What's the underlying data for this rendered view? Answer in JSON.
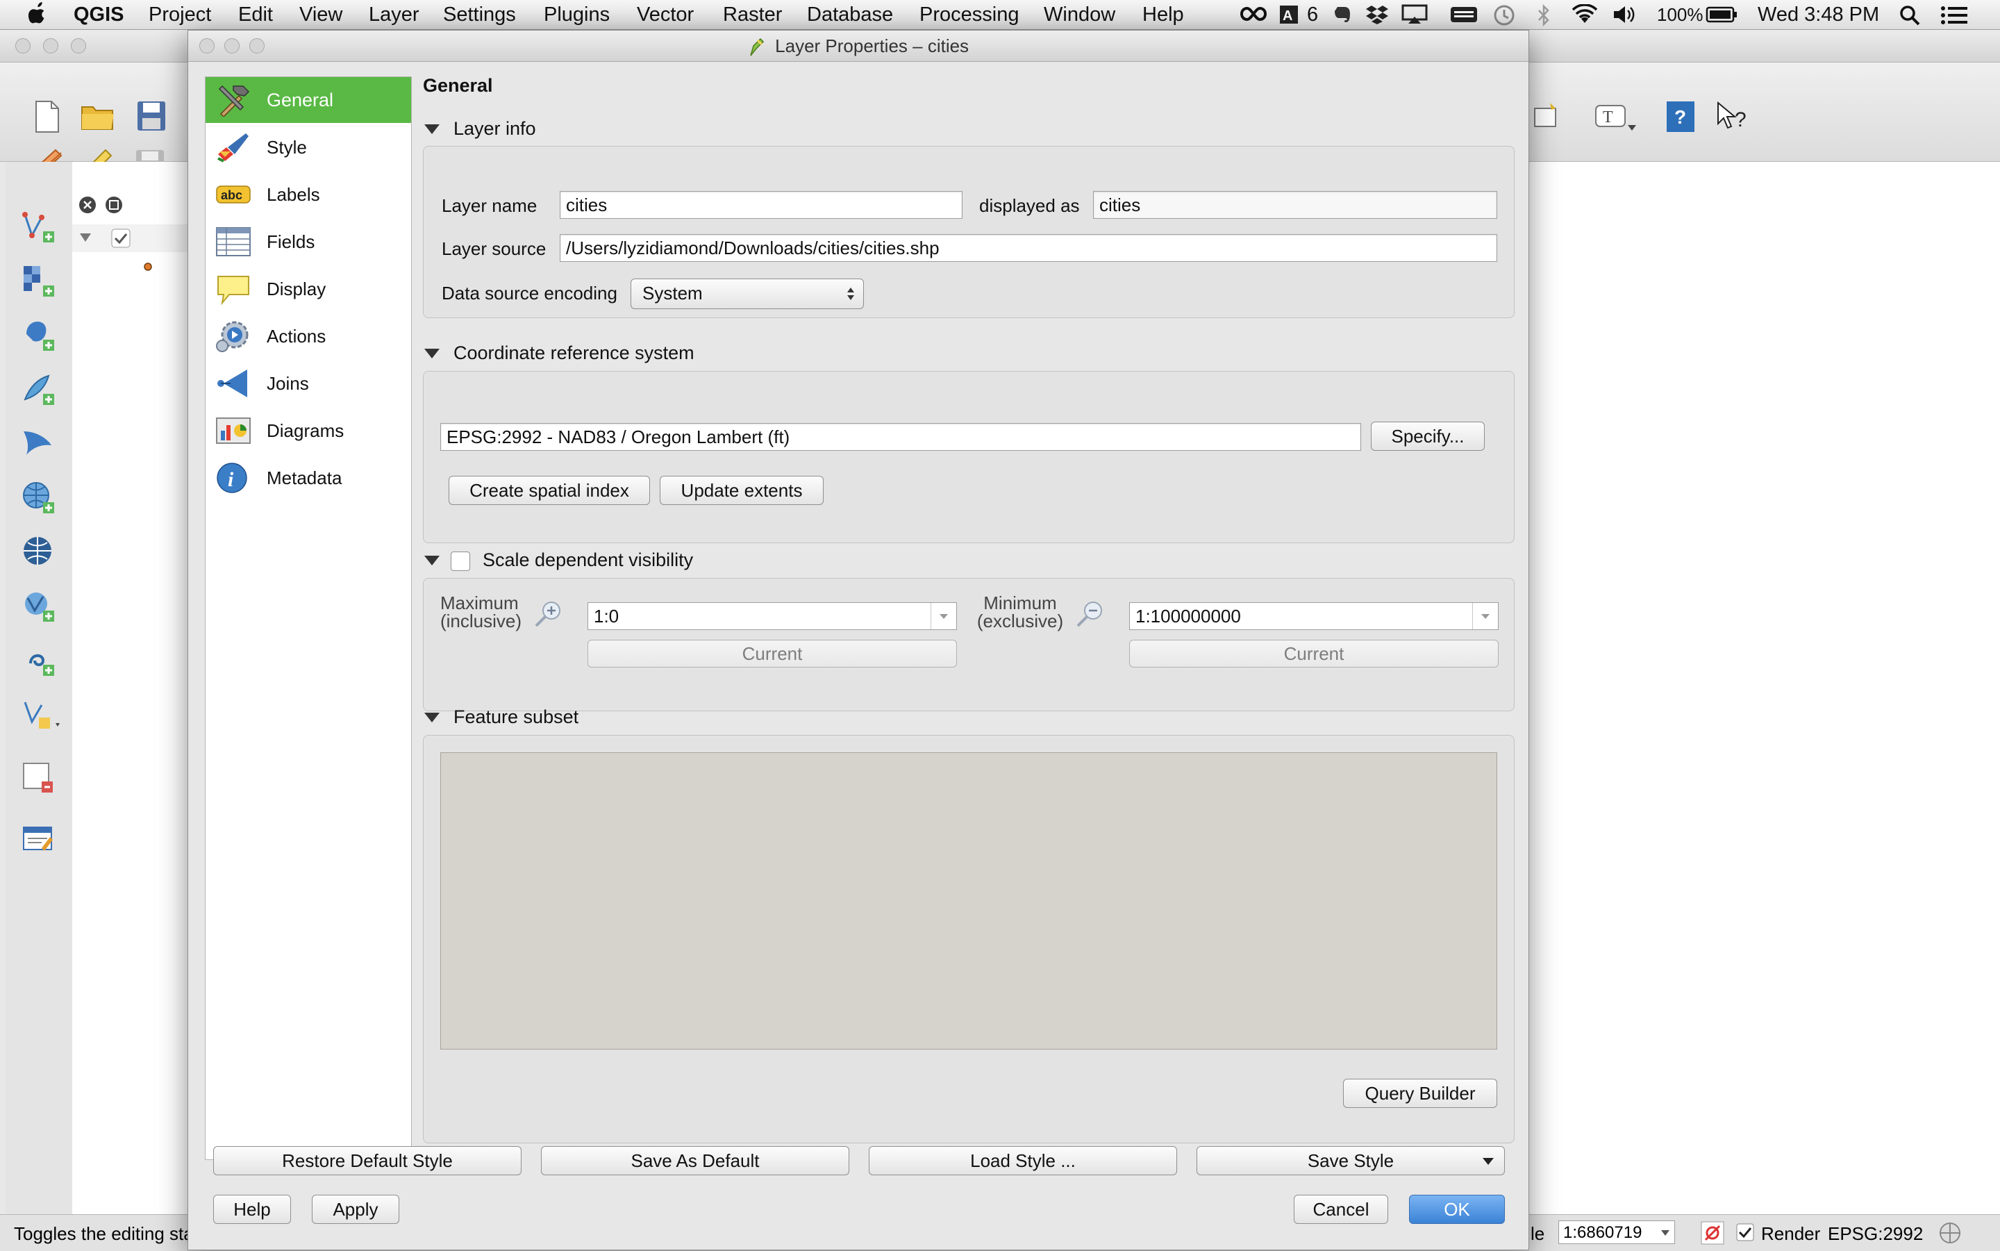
{
  "menubar": {
    "app_name": "QGIS",
    "items": [
      "Project",
      "Edit",
      "View",
      "Layer",
      "Settings",
      "Plugins",
      "Vector",
      "Raster",
      "Database",
      "Processing",
      "Window",
      "Help"
    ],
    "status_badge_count": "6",
    "battery": "100%",
    "clock": "Wed 3:48 PM"
  },
  "dialog": {
    "title": "Layer Properties – cities",
    "sidebar": [
      {
        "label": "General",
        "icon": "hammer-icon",
        "selected": true
      },
      {
        "label": "Style",
        "icon": "paintbrush-icon"
      },
      {
        "label": "Labels",
        "icon": "abc-label-icon"
      },
      {
        "label": "Fields",
        "icon": "table-fields-icon"
      },
      {
        "label": "Display",
        "icon": "speech-bubble-icon"
      },
      {
        "label": "Actions",
        "icon": "gear-play-icon"
      },
      {
        "label": "Joins",
        "icon": "joins-icon"
      },
      {
        "label": "Diagrams",
        "icon": "diagram-chart-icon"
      },
      {
        "label": "Metadata",
        "icon": "info-icon"
      }
    ],
    "page_title": "General",
    "layer_info": {
      "section_title": "Layer info",
      "layer_name_label": "Layer name",
      "layer_name_value": "cities",
      "displayed_as_label": "displayed as",
      "displayed_as_value": "cities",
      "layer_source_label": "Layer source",
      "layer_source_value": "/Users/lyzidiamond/Downloads/cities/cities.shp",
      "encoding_label": "Data source encoding",
      "encoding_value": "System"
    },
    "crs": {
      "section_title": "Coordinate reference system",
      "value": "EPSG:2992 - NAD83 / Oregon Lambert (ft)",
      "specify_button": "Specify...",
      "create_index_button": "Create spatial index",
      "update_extents_button": "Update extents"
    },
    "scale": {
      "section_title": "Scale dependent visibility",
      "enabled": false,
      "maximum_label_1": "Maximum",
      "maximum_label_2": "(inclusive)",
      "maximum_value": "1:0",
      "minimum_label_1": "Minimum",
      "minimum_label_2": "(exclusive)",
      "minimum_value": "1:100000000",
      "current_button": "Current"
    },
    "feature_subset": {
      "section_title": "Feature subset",
      "query_builder_button": "Query Builder"
    },
    "buttons": {
      "restore_default_style": "Restore Default Style",
      "save_as_default": "Save As Default",
      "load_style": "Load Style ...",
      "save_style": "Save Style",
      "help": "Help",
      "apply": "Apply",
      "cancel": "Cancel",
      "ok": "OK"
    }
  },
  "statusbar": {
    "hint_text": "Toggles the editing sta",
    "scale_label_fragment": "le",
    "scale_value": "1:6860719",
    "render_label": "Render",
    "crs_label": "EPSG:2992"
  },
  "colors": {
    "selected_item": "#59b944",
    "default_button": "#3b82d6"
  }
}
